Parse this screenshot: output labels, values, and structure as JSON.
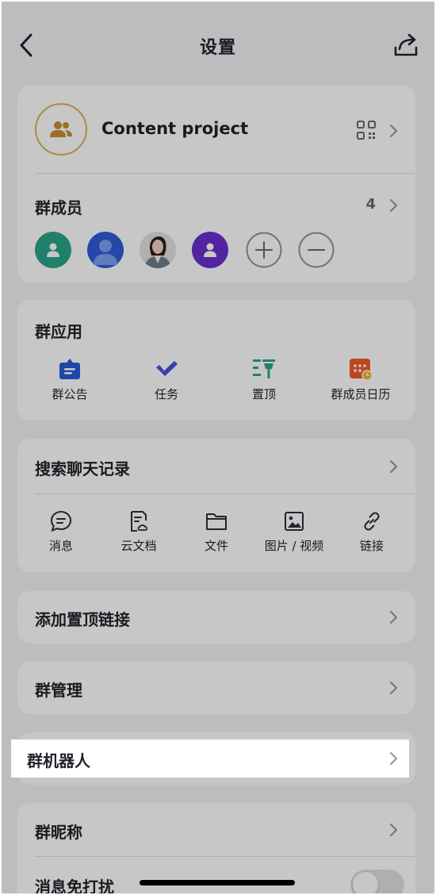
{
  "header": {
    "title": "设置",
    "back_icon": "chevron-left-icon",
    "share_icon": "share-icon"
  },
  "group": {
    "name": "Content project",
    "avatar_icon": "group-icon",
    "qr_icon": "qr-code-icon"
  },
  "members": {
    "label": "群成员",
    "count": "4",
    "avatars": [
      {
        "type": "default",
        "color": "#2ba58a"
      },
      {
        "type": "default",
        "color": "#2f5bd9"
      },
      {
        "type": "photo",
        "color": "#d9d4d0"
      },
      {
        "type": "default",
        "color": "#6a2fd0"
      }
    ],
    "add_icon": "plus-circle-icon",
    "remove_icon": "minus-circle-icon"
  },
  "apps": {
    "label": "群应用",
    "items": [
      {
        "label": "群公告",
        "icon": "announcement-icon",
        "color": "#245bdb"
      },
      {
        "label": "任务",
        "icon": "task-check-icon",
        "color": "#4a4fe0"
      },
      {
        "label": "置顶",
        "icon": "pin-icon",
        "color": "#2ba58a"
      },
      {
        "label": "群成员日历",
        "icon": "calendar-icon",
        "color": "#f05a28"
      }
    ]
  },
  "chat_search": {
    "label": "搜索聊天记录",
    "items": [
      {
        "label": "消息",
        "icon": "message-icon"
      },
      {
        "label": "云文档",
        "icon": "cloud-doc-icon"
      },
      {
        "label": "文件",
        "icon": "folder-icon"
      },
      {
        "label": "图片 / 视频",
        "icon": "image-icon"
      },
      {
        "label": "链接",
        "icon": "link-icon"
      }
    ]
  },
  "rows": {
    "pinned_link": "添加置顶链接",
    "group_manage": "群管理",
    "group_bot": "群机器人",
    "nickname": "群昵称",
    "mute": "消息免打扰"
  },
  "mute_toggle": {
    "on": false
  },
  "colors": {
    "accent_gold": "#d8b25e",
    "page_bg": "#f2f3f5",
    "card_bg": "#ffffff"
  }
}
